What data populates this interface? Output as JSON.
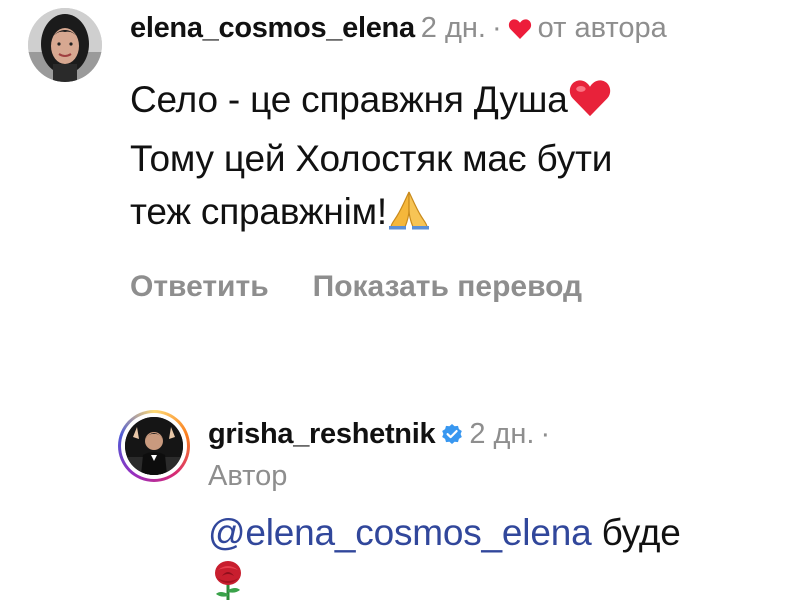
{
  "comment": {
    "username": "elena_cosmos_elena",
    "time": "2 дн.",
    "separator": "·",
    "liked_by_author_label": "от автора",
    "text_line1": "Село - це справжня Душа",
    "text_line2": "Тому цей Холостяк має бути",
    "text_line3": "теж справжнім!",
    "emoji_line1": "red-heart",
    "emoji_line3": "folded-hands",
    "actions": {
      "reply": "Ответить",
      "translate": "Показать перевод"
    }
  },
  "reply": {
    "username": "grisha_reshetnik",
    "verified": true,
    "time": "2 дн.",
    "separator": "·",
    "author_badge": "Автор",
    "mention": "@elena_cosmos_elena",
    "text": "буде",
    "emoji": "rose"
  },
  "colors": {
    "text": "#111111",
    "secondary": "#8e8e8e",
    "mention": "#31479b",
    "heart": "#ed1c3a",
    "verified": "#3897f0"
  }
}
